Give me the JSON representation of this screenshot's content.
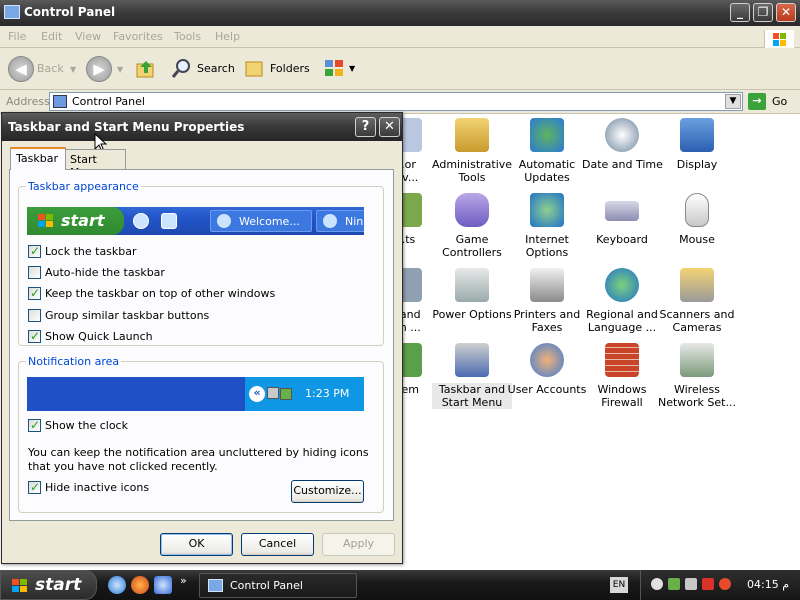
{
  "window": {
    "title": "Control Panel",
    "controls": {
      "minimize": "_",
      "maximize": "❐",
      "close": "✕"
    }
  },
  "menubar": [
    "File",
    "Edit",
    "View",
    "Favorites",
    "Tools",
    "Help"
  ],
  "toolbar": {
    "back": "Back",
    "search": "Search",
    "folders": "Folders"
  },
  "address": {
    "label": "Address",
    "value": "Control Panel",
    "go": "Go"
  },
  "items": [
    {
      "label": "...or\n...v..."
    },
    {
      "label": "Administrative\nTools"
    },
    {
      "label": "Automatic\nUpdates"
    },
    {
      "label": "Date and Time"
    },
    {
      "label": "Display"
    },
    {
      "label": "...ts"
    },
    {
      "label": "Game\nControllers"
    },
    {
      "label": "Internet\nOptions"
    },
    {
      "label": "Keyboard"
    },
    {
      "label": "Mouse"
    },
    {
      "label": "...and\n...n ..."
    },
    {
      "label": "Power Options"
    },
    {
      "label": "Printers and\nFaxes"
    },
    {
      "label": "Regional and\nLanguage ..."
    },
    {
      "label": "Scanners and\nCameras"
    },
    {
      "label": "...em"
    },
    {
      "label": "Taskbar and\nStart Menu"
    },
    {
      "label": "User Accounts"
    },
    {
      "label": "Windows\nFirewall"
    },
    {
      "label": "Wireless\nNetwork Set..."
    }
  ],
  "dialog": {
    "title": "Taskbar and Start Menu Properties",
    "help": "?",
    "close": "✕",
    "tabs": [
      "Taskbar",
      "Start Menu"
    ],
    "appearance": {
      "title": "Taskbar appearance",
      "preview": {
        "start": "start",
        "task1": "Welcome...",
        "task2": "Nin"
      },
      "options": [
        {
          "label": "Lock the taskbar",
          "checked": true
        },
        {
          "label": "Auto-hide the taskbar",
          "checked": false
        },
        {
          "label": "Keep the taskbar on top of other windows",
          "checked": true
        },
        {
          "label": "Group similar taskbar buttons",
          "checked": false
        },
        {
          "label": "Show Quick Launch",
          "checked": true
        }
      ]
    },
    "notification": {
      "title": "Notification area",
      "preview_time": "1:23 PM",
      "show_clock": {
        "label": "Show the clock",
        "checked": true
      },
      "description": "You can keep the notification area uncluttered by hiding icons that you have not clicked recently.",
      "hide_inactive": {
        "label": "Hide inactive icons",
        "checked": true
      },
      "customize": "Customize..."
    },
    "buttons": {
      "ok": "OK",
      "cancel": "Cancel",
      "apply": "Apply"
    }
  },
  "taskbar": {
    "start": "start",
    "task": "Control Panel",
    "language": "EN",
    "clock": "04:15 م"
  },
  "colors": {
    "accent": "#0046d5",
    "check": "#21a121",
    "tab_highlight": "#e68b2c"
  }
}
